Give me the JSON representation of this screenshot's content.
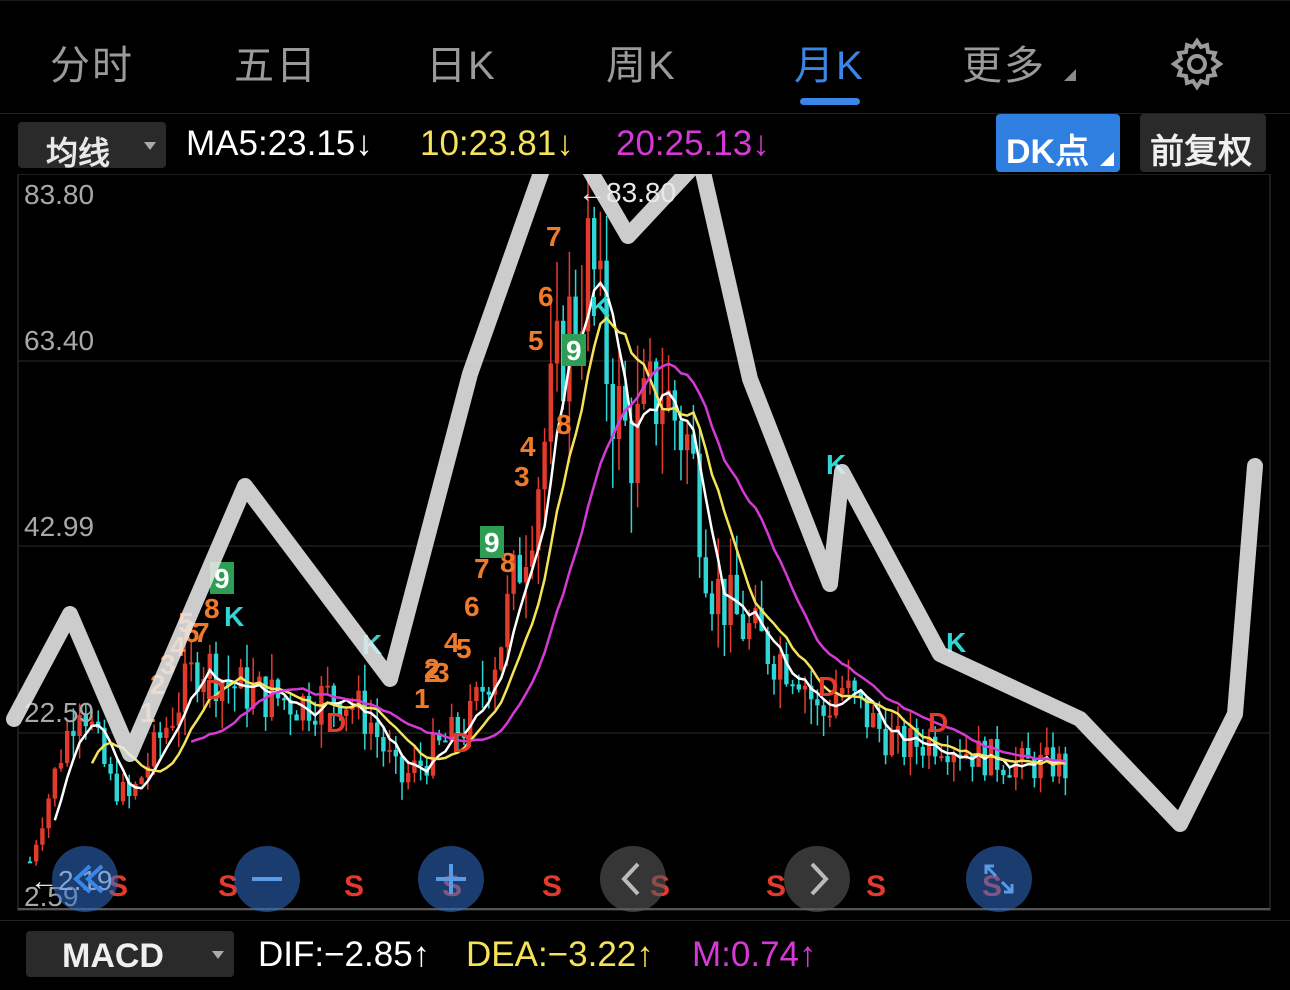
{
  "tabs": [
    {
      "label": "分时",
      "active": false
    },
    {
      "label": "五日",
      "active": false
    },
    {
      "label": "日K",
      "active": false
    },
    {
      "label": "周K",
      "active": false
    },
    {
      "label": "月K",
      "active": true
    },
    {
      "label": "更多",
      "active": false
    }
  ],
  "settings_icon": "gear-icon",
  "toolbar": {
    "ma_select": "均线",
    "ma5": "MA5:23.15↓",
    "ma10": "10:23.81↓",
    "ma20": "20:25.13↓",
    "dk_button": "DK点",
    "fq_button": "前复权"
  },
  "colors": {
    "accent": "#3a86e6",
    "up": "#e23b2e",
    "down": "#2fd6d6",
    "ma5": "#ffffff",
    "ma10": "#f4e35a",
    "ma20": "#d63ad6",
    "dk_signal": "#f07a2a",
    "nine_signal": "#2f9e55"
  },
  "chart_data": {
    "type": "candlestick",
    "y_ticks": [
      "83.80",
      "63.40",
      "42.99",
      "22.59",
      "2.59"
    ],
    "ylim": [
      2.59,
      83.8
    ],
    "high_label": "←83.80",
    "low_label": "←2.19",
    "signals": {
      "K": "K",
      "D": "D",
      "S": "S"
    },
    "countdown_digits": [
      "1",
      "2",
      "3",
      "4",
      "5",
      "6",
      "7",
      "8",
      "9",
      "1",
      "2",
      "3",
      "4",
      "5",
      "6",
      "7",
      "8",
      "9",
      "2",
      "3",
      "4",
      "5",
      "6",
      "7",
      "8",
      "9"
    ]
  },
  "macd": {
    "select": "MACD",
    "dif": "DIF:−2.85↑",
    "dea": "DEA:−3.22↑",
    "m": "M:0.74↑"
  },
  "controls": [
    {
      "icon": "fast-rewind-icon"
    },
    {
      "icon": "zoom-out-icon"
    },
    {
      "icon": "zoom-in-icon"
    },
    {
      "icon": "prev-icon"
    },
    {
      "icon": "next-icon"
    },
    {
      "icon": "fullscreen-icon"
    }
  ]
}
